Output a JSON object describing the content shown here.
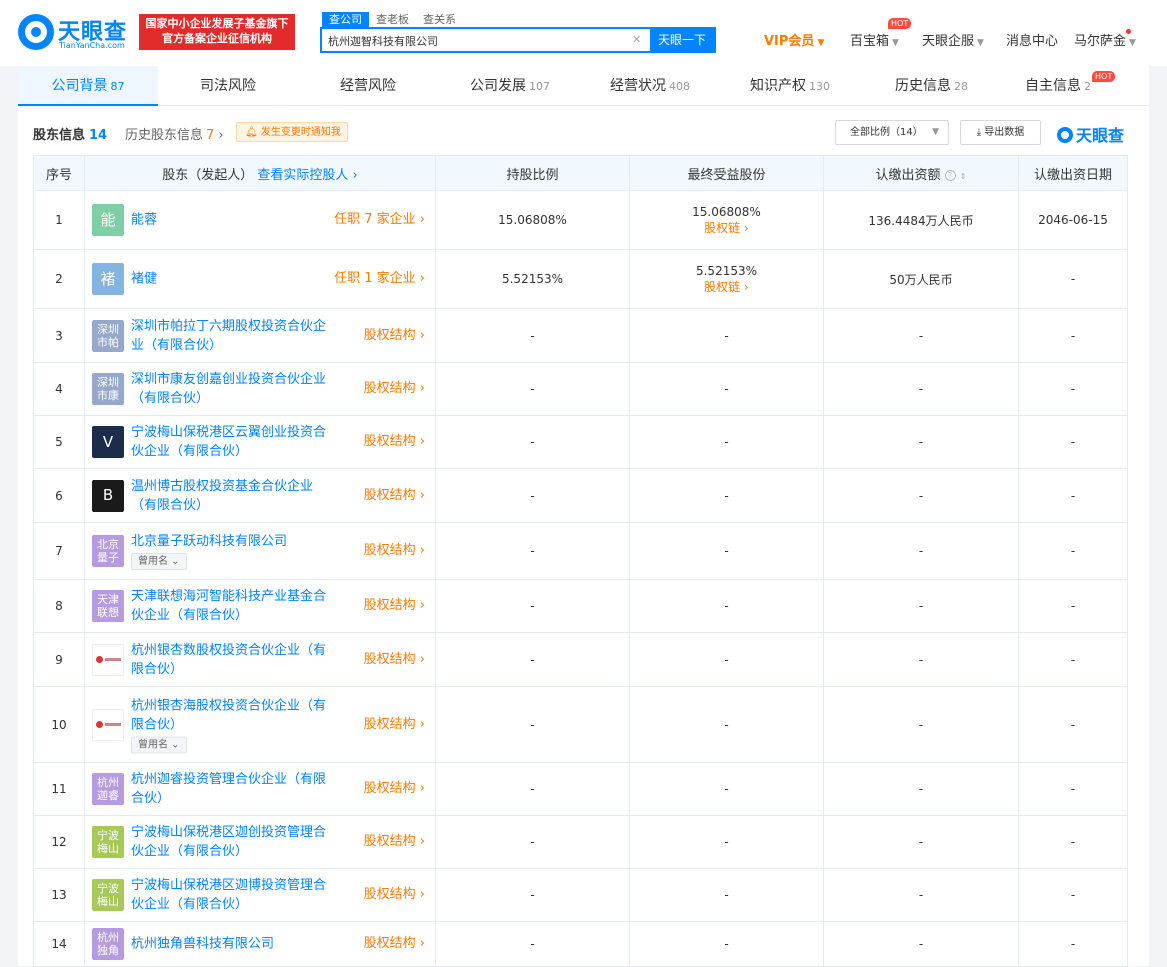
{
  "header": {
    "logo_text": "天眼查",
    "logo_sub": "TianYanCha.com",
    "badge_line1": "国家中小企业发展子基金旗下",
    "badge_line2": "官方备案企业征信机构",
    "search_tabs": [
      "查公司",
      "查老板",
      "查关系"
    ],
    "search_value": "杭州迦智科技有限公司",
    "search_button": "天眼一下",
    "nav": {
      "vip": "VIP会员",
      "baibaoxiang": "百宝箱",
      "hot": "HOT",
      "qifu": "天眼企服",
      "messages": "消息中心",
      "user": "马尔萨金"
    }
  },
  "tabs": [
    {
      "label": "公司背景",
      "count": "87"
    },
    {
      "label": "司法风险",
      "count": ""
    },
    {
      "label": "经营风险",
      "count": ""
    },
    {
      "label": "公司发展",
      "count": "107"
    },
    {
      "label": "经营状况",
      "count": "408"
    },
    {
      "label": "知识产权",
      "count": "130"
    },
    {
      "label": "历史信息",
      "count": "28"
    },
    {
      "label": "自主信息",
      "count": "2",
      "hot": "HOT"
    }
  ],
  "section": {
    "title": "股东信息",
    "count": "14",
    "history": "历史股东信息",
    "history_count": "7",
    "notice": "发生变更时通知我",
    "filter": "全部比例（14）",
    "export": "导出数据",
    "watermark": "天眼查"
  },
  "columns": {
    "index": "序号",
    "shareholder": "股东（发起人）",
    "link": "查看实际控股人",
    "ratio": "持股比例",
    "final": "最终受益股份",
    "capital": "认缴出资额",
    "date": "认缴出资日期"
  },
  "rows": [
    {
      "idx": "1",
      "avatar": "能",
      "color": "#7fcfa5",
      "name": "能蓉",
      "right": "任职 7 家企业",
      "ratio": "15.06808%",
      "final": "15.06808%",
      "final_link": "股权链",
      "capital": "136.4484万人民币",
      "date": "2046-06-15"
    },
    {
      "idx": "2",
      "avatar": "褚",
      "color": "#84b4e0",
      "name": "褚健",
      "right": "任职 1 家企业",
      "ratio": "5.52153%",
      "final": "5.52153%",
      "final_link": "股权链",
      "capital": "50万人民币",
      "date": "-"
    },
    {
      "idx": "3",
      "avatar": "深圳市帕",
      "color": "#96a9cc",
      "name": "深圳市帕拉丁六期股权投资合伙企业（有限合伙）",
      "right": "股权结构",
      "ratio": "-",
      "final": "-",
      "capital": "-",
      "date": "-"
    },
    {
      "idx": "4",
      "avatar": "深圳市康",
      "color": "#96a9cc",
      "name": "深圳市康友创嘉创业投资合伙企业（有限合伙）",
      "right": "股权结构",
      "ratio": "-",
      "final": "-",
      "capital": "-",
      "date": "-"
    },
    {
      "idx": "5",
      "avatar": "V",
      "color": "#1c2c4c",
      "name": "宁波梅山保税港区云翼创业投资合伙企业（有限合伙）",
      "right": "股权结构",
      "ratio": "-",
      "final": "-",
      "capital": "-",
      "date": "-"
    },
    {
      "idx": "6",
      "avatar": "B",
      "color": "#1a1a1a",
      "name": "温州博古股权投资基金合伙企业（有限合伙）",
      "right": "股权结构",
      "ratio": "-",
      "final": "-",
      "capital": "-",
      "date": "-"
    },
    {
      "idx": "7",
      "avatar": "北京量子",
      "color": "#b79be0",
      "name": "北京量子跃动科技有限公司",
      "alias": "曾用名",
      "right": "股权结构",
      "ratio": "-",
      "final": "-",
      "capital": "-",
      "date": "-"
    },
    {
      "idx": "8",
      "avatar": "天津联想",
      "color": "#b79be0",
      "name": "天津联想海河智能科技产业基金合伙企业（有限合伙）",
      "right": "股权结构",
      "ratio": "-",
      "final": "-",
      "capital": "-",
      "date": "-"
    },
    {
      "idx": "9",
      "avatar": "",
      "color": "#ffffff",
      "name": "杭州银杏数股权投资合伙企业（有限合伙）",
      "right": "股权结构",
      "ratio": "-",
      "final": "-",
      "capital": "-",
      "date": "-"
    },
    {
      "idx": "10",
      "avatar": "",
      "color": "#ffffff",
      "name": "杭州银杏海股权投资合伙企业（有限合伙）",
      "alias": "曾用名",
      "right": "股权结构",
      "ratio": "-",
      "final": "-",
      "capital": "-",
      "date": "-"
    },
    {
      "idx": "11",
      "avatar": "杭州迦睿",
      "color": "#b79be0",
      "name": "杭州迦睿投资管理合伙企业（有限合伙）",
      "right": "股权结构",
      "ratio": "-",
      "final": "-",
      "capital": "-",
      "date": "-"
    },
    {
      "idx": "12",
      "avatar": "宁波梅山",
      "color": "#a7c958",
      "name": "宁波梅山保税港区迦创投资管理合伙企业（有限合伙）",
      "right": "股权结构",
      "ratio": "-",
      "final": "-",
      "capital": "-",
      "date": "-"
    },
    {
      "idx": "13",
      "avatar": "宁波梅山",
      "color": "#a7c958",
      "name": "宁波梅山保税港区迦博投资管理合伙企业（有限合伙）",
      "right": "股权结构",
      "ratio": "-",
      "final": "-",
      "capital": "-",
      "date": "-"
    },
    {
      "idx": "14",
      "avatar": "杭州独角",
      "color": "#b79be0",
      "name": "杭州独角兽科技有限公司",
      "right": "股权结构",
      "ratio": "-",
      "final": "-",
      "capital": "-",
      "date": "-"
    }
  ]
}
